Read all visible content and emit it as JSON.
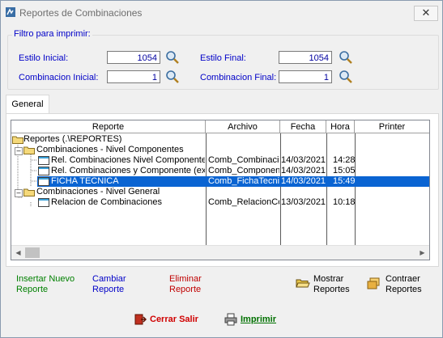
{
  "window": {
    "title": "Reportes de Combinaciones",
    "close_glyph": "✕"
  },
  "filter": {
    "legend": "Filtro para imprimir:",
    "estilo_inicial_label": "Estilo Inicial:",
    "estilo_inicial_value": "1054",
    "estilo_final_label": "Estilo Final:",
    "estilo_final_value": "1054",
    "comb_inicial_label": "Combinacion Inicial:",
    "comb_inicial_value": "1",
    "comb_final_label": "Combinacion Final:",
    "comb_final_value": "1"
  },
  "tabs": [
    {
      "label": "General"
    }
  ],
  "grid": {
    "columns": [
      "Reporte",
      "Archivo",
      "Fecha",
      "Hora",
      "Printer"
    ],
    "rows": [
      {
        "name": "Reportes (.\\REPORTES)",
        "archivo": "",
        "fecha": "",
        "hora": "",
        "printer": "",
        "level": 0,
        "icon": "folder-icon"
      },
      {
        "name": "Combinaciones - Nivel Componentes",
        "archivo": "",
        "fecha": "",
        "hora": "",
        "printer": "",
        "level": 1,
        "icon": "folder-icon"
      },
      {
        "name": "Rel. Combinaciones Nivel Componente",
        "archivo": "Comb_Combinacio",
        "fecha": "14/03/2021",
        "hora": "14:28",
        "printer": "",
        "level": 2,
        "icon": "report-icon"
      },
      {
        "name": "Rel. Combinaciones y Componente (exce",
        "archivo": "Comb_Component",
        "fecha": "14/03/2021",
        "hora": "15:05",
        "printer": "",
        "level": 2,
        "icon": "report-icon"
      },
      {
        "name": "FICHA TECNICA",
        "archivo": "Comb_FichaTecni",
        "fecha": "14/03/2021",
        "hora": "15:49",
        "printer": "",
        "level": 2,
        "icon": "report-icon",
        "selected": true
      },
      {
        "name": "Combinaciones - Nivel General",
        "archivo": "",
        "fecha": "",
        "hora": "",
        "printer": "",
        "level": 1,
        "icon": "folder-icon"
      },
      {
        "name": "Relacion de Combinaciones",
        "archivo": "Comb_RelacionCo",
        "fecha": "13/03/2021",
        "hora": "10:18",
        "printer": "",
        "level": 2,
        "icon": "report-icon"
      }
    ]
  },
  "actions": {
    "insertar_line1": "Insertar Nuevo",
    "insertar_line2": "Reporte",
    "cambiar_line1": "Cambiar",
    "cambiar_line2": "Reporte",
    "eliminar_line1": "Eliminar",
    "eliminar_line2": "Reporte",
    "mostrar_line1": "Mostrar",
    "mostrar_line2": "Reportes",
    "contraer_line1": "Contraer",
    "contraer_line2": "Reportes"
  },
  "footer": {
    "cerrar_label": "Cerrar Salir",
    "imprimir_label": "Imprimir"
  },
  "colors": {
    "selection": "#0a64d2",
    "label_blue": "#0000c8",
    "insert_green": "#008000",
    "delete_red": "#c00000",
    "cerrar_red": "#d00000",
    "imprimir_green": "#007000"
  }
}
